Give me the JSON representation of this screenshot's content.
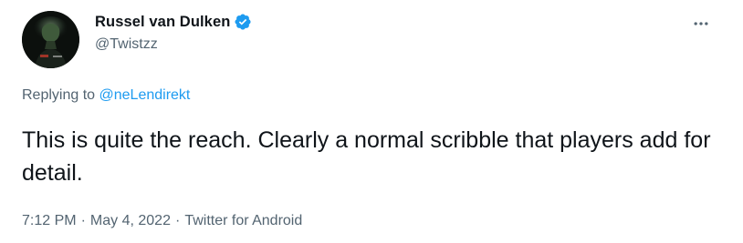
{
  "author": {
    "display_name": "Russel van Dulken",
    "handle": "@Twistzz",
    "verified": true,
    "avatar_icon": "user-avatar-icon"
  },
  "reply": {
    "prefix": "Replying to ",
    "mention": "@neLendirekt"
  },
  "tweet": {
    "text": "This is quite the reach. Clearly a normal scribble that players add for detail."
  },
  "meta": {
    "time": "7:12 PM",
    "separator": "·",
    "date": "May 4, 2022",
    "source": "Twitter for Android"
  },
  "colors": {
    "text_primary": "#0f1419",
    "text_secondary": "#536471",
    "accent_blue": "#1d9bf0"
  },
  "icons": {
    "verified": "verified-badge-icon",
    "more": "more-horizontal-icon"
  }
}
